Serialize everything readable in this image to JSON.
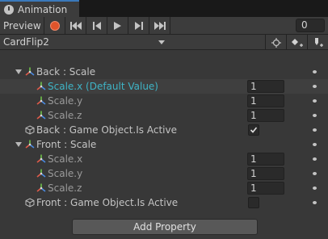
{
  "window": {
    "tab_title": "Animation"
  },
  "toolbar": {
    "preview_label": "Preview",
    "frame_value": "0"
  },
  "clip": {
    "selected": "CardFlip2"
  },
  "colors": {
    "accent": "#3a79bb",
    "record": "#e0542b",
    "highlight_text": "#3fb4c6"
  },
  "properties": [
    {
      "label": "Back : Scale",
      "icon": "transform-icon",
      "level": 0,
      "expanded": true
    },
    {
      "label": "Scale.x (Default Value)",
      "icon": "transform-icon",
      "level": 1,
      "value": "1",
      "highlight": true
    },
    {
      "label": "Scale.y",
      "icon": "transform-icon",
      "level": 1,
      "value": "1"
    },
    {
      "label": "Scale.z",
      "icon": "transform-icon",
      "level": 1,
      "value": "1"
    },
    {
      "label": "Back : Game Object.Is Active",
      "icon": "gameobject-icon",
      "level": 0,
      "checked": true
    },
    {
      "label": "Front : Scale",
      "icon": "transform-icon",
      "level": 0,
      "expanded": true
    },
    {
      "label": "Scale.x",
      "icon": "transform-icon",
      "level": 1,
      "value": "1"
    },
    {
      "label": "Scale.y",
      "icon": "transform-icon",
      "level": 1,
      "value": "1"
    },
    {
      "label": "Scale.z",
      "icon": "transform-icon",
      "level": 1,
      "value": "1"
    },
    {
      "label": "Front : Game Object.Is Active",
      "icon": "gameobject-icon",
      "level": 0,
      "checked": false
    }
  ],
  "footer": {
    "add_property_label": "Add Property"
  }
}
